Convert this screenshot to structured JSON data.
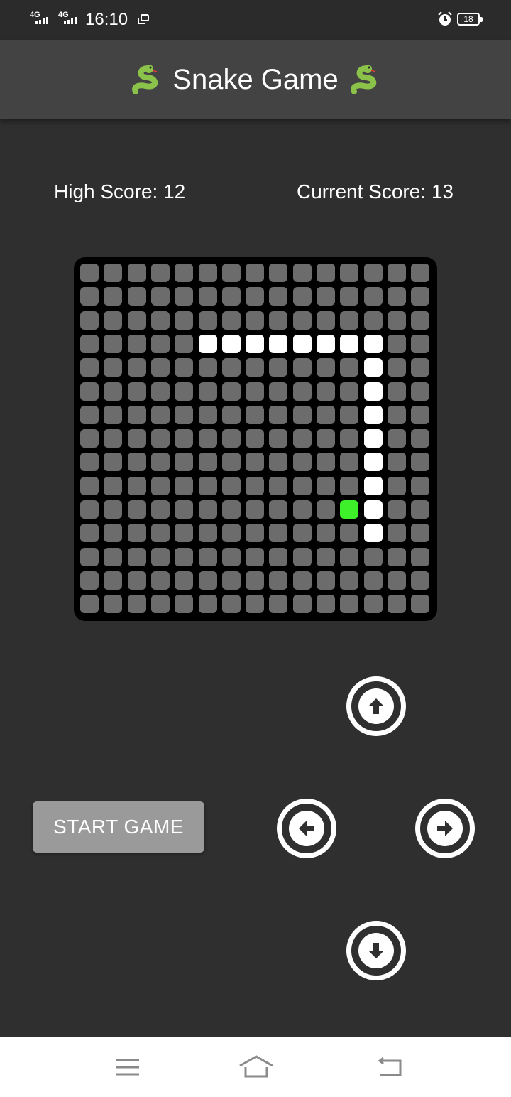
{
  "status_bar": {
    "signal1": "4G",
    "signal2": "4G",
    "time": "16:10",
    "battery": "18"
  },
  "app": {
    "title": "Snake Game",
    "title_icon": "snake-emoji"
  },
  "scores": {
    "high": "High Score: 12",
    "current": "Current Score: 13"
  },
  "board": {
    "grid_size": 15,
    "snake": [
      [
        3,
        5
      ],
      [
        3,
        6
      ],
      [
        3,
        7
      ],
      [
        3,
        8
      ],
      [
        3,
        9
      ],
      [
        3,
        10
      ],
      [
        3,
        11
      ],
      [
        3,
        12
      ],
      [
        4,
        12
      ],
      [
        5,
        12
      ],
      [
        6,
        12
      ],
      [
        7,
        12
      ],
      [
        8,
        12
      ],
      [
        9,
        12
      ],
      [
        10,
        12
      ],
      [
        11,
        12
      ]
    ],
    "food": [
      10,
      11
    ],
    "colors": {
      "board": "#000000",
      "empty": "#6c6c6c",
      "snake": "#ffffff",
      "food": "#3ef02a"
    }
  },
  "controls": {
    "start_label": "START GAME",
    "icons": [
      "arrow-up-icon",
      "arrow-left-icon",
      "arrow-right-icon",
      "arrow-down-icon"
    ]
  },
  "nav": {
    "icons": [
      "menu-icon",
      "home-icon",
      "back-icon"
    ]
  }
}
